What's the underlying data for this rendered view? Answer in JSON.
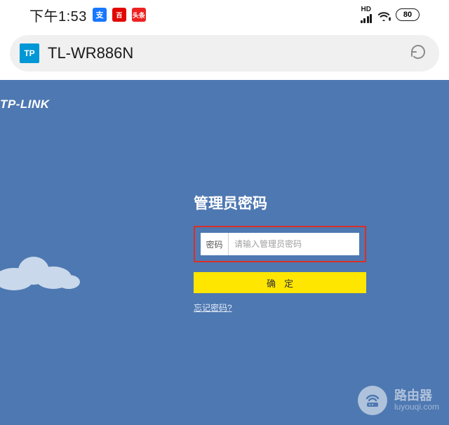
{
  "status": {
    "time": "下午1:53",
    "battery": "80",
    "hd_label": "HD"
  },
  "browser": {
    "site_icon_text": "TP",
    "address": "TL-WR886N"
  },
  "page": {
    "brand": "TP-LINK",
    "login": {
      "title": "管理员密码",
      "field_label": "密码",
      "placeholder": "请输入管理员密码",
      "submit": "确定",
      "forgot": "忘记密码?"
    }
  },
  "watermark": {
    "title": "路由器",
    "domain": "luyouqi.com"
  }
}
